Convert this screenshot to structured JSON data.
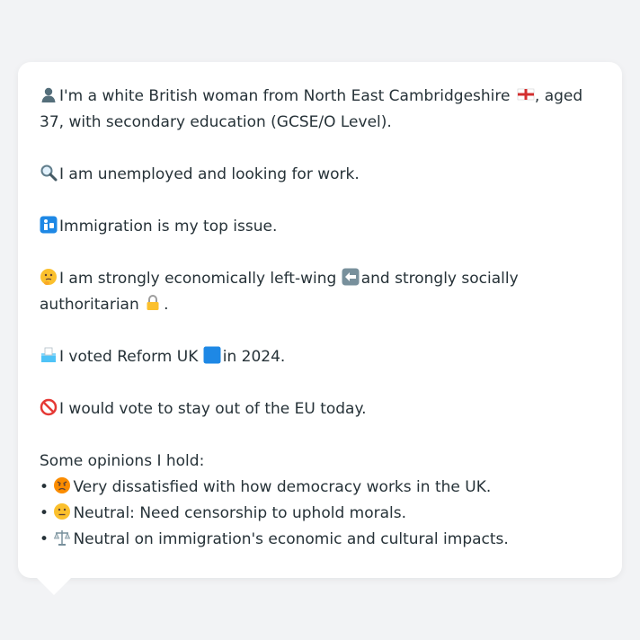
{
  "profile": {
    "line1_a": "I'm a white British woman from North East Cambridgeshire",
    "line1_b": ", aged 37, with secondary education (GCSE/O Level).",
    "employment": "I am unemployed and looking for work.",
    "top_issue": "Immigration is my top issue.",
    "ideology_a": "I am strongly economically left-wing",
    "ideology_b": "and strongly socially authoritarian",
    "ideology_end": ".",
    "vote_a": "I voted Reform UK",
    "vote_b": "in 2024.",
    "eu": "I would vote to stay out of the EU today."
  },
  "opinions": {
    "heading": "Some opinions I hold:",
    "items": [
      {
        "bullet": "•",
        "icon": "angry-face-icon",
        "text": "Very dissatisfied with how democracy works in the UK."
      },
      {
        "bullet": "•",
        "icon": "neutral-face-icon",
        "text": "Neutral: Need censorship to uphold morals."
      },
      {
        "bullet": "•",
        "icon": "balance-scale-icon",
        "text": "Neutral on immigration's economic and cultural impacts."
      }
    ]
  },
  "icons": {
    "person": "person-silhouette-icon",
    "flag": "england-flag-icon",
    "search": "magnifying-glass-icon",
    "passport": "passport-control-icon",
    "thinking": "thinking-face-icon",
    "left_arrow": "left-arrow-icon",
    "lock": "lock-icon",
    "ballot": "ballot-box-icon",
    "blue_square": "blue-square-icon",
    "prohibited": "prohibited-icon"
  },
  "colors": {
    "background": "#f2f3f5",
    "card": "#ffffff",
    "text": "#263238",
    "reform_blue": "#1e88e5"
  }
}
